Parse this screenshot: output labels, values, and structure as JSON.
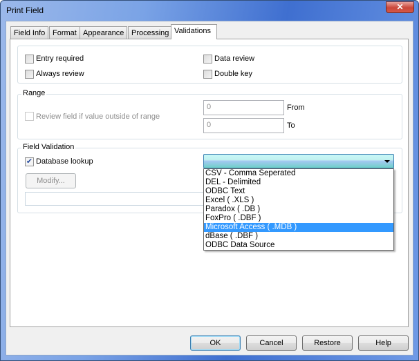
{
  "window": {
    "title": "Print Field",
    "close_glyph": "✕"
  },
  "tabs": [
    {
      "label": "Field Info"
    },
    {
      "label": "Format"
    },
    {
      "label": "Appearance"
    },
    {
      "label": "Processing"
    },
    {
      "label": "Validations",
      "active": true
    }
  ],
  "options": {
    "entry_required": {
      "label": "Entry required",
      "checked": false
    },
    "always_review": {
      "label": "Always review",
      "checked": false
    },
    "data_review": {
      "label": "Data review",
      "checked": false
    },
    "double_key": {
      "label": "Double key",
      "checked": false
    }
  },
  "range": {
    "title": "Range",
    "review_label": "Review field if value outside of range",
    "review_checked": false,
    "from_value": "0",
    "from_label": "From",
    "to_value": "0",
    "to_label": "To"
  },
  "field_validation": {
    "title": "Field Validation",
    "database_lookup_label": "Database lookup",
    "database_lookup_checked": true,
    "modify_label": "Modify...",
    "combo_value": "",
    "dropdown_items": [
      "CSV - Comma Seperated",
      "DEL - Delimited",
      "ODBC Text",
      "Excel ( .XLS )",
      "Paradox ( .DB )",
      "FoxPro ( .DBF )",
      "Microsoft Access ( .MDB )",
      "dBase ( .DBF )",
      "ODBC Data Source"
    ],
    "selected_item": "Microsoft Access ( .MDB )"
  },
  "buttons": {
    "ok": "OK",
    "cancel": "Cancel",
    "restore": "Restore",
    "help": "Help"
  }
}
